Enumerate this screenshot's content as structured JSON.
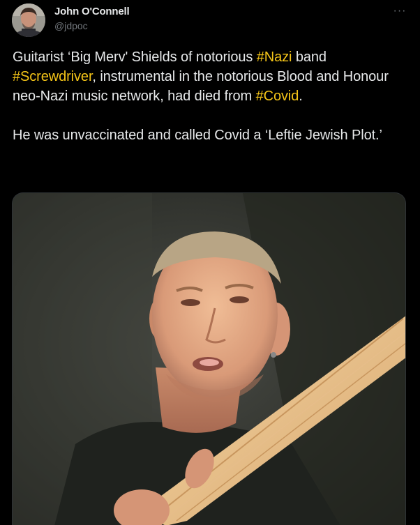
{
  "tweet": {
    "author_name": "John O'Connell",
    "author_handle": "@jdpoc",
    "more_label": "···",
    "paragraph1": {
      "t1": "Guitarist ‘Big Merv' Shields of notorious ",
      "h1": "#Nazi",
      "t2": " band ",
      "h2": "#Screwdriver",
      "t3": ", instrumental in the notorious Blood and Honour neo-Nazi music network, had died from ",
      "h3": "#Covid",
      "t4": "."
    },
    "paragraph2": "He was unvaccinated and called Covid a ‘Leftie Jewish Plot.’"
  },
  "colors": {
    "background": "#000000",
    "text": "#e7e9ea",
    "secondary": "#71767b",
    "hashtag": "#f5c518"
  },
  "icons": {
    "more": "more-horizontal-icon"
  }
}
